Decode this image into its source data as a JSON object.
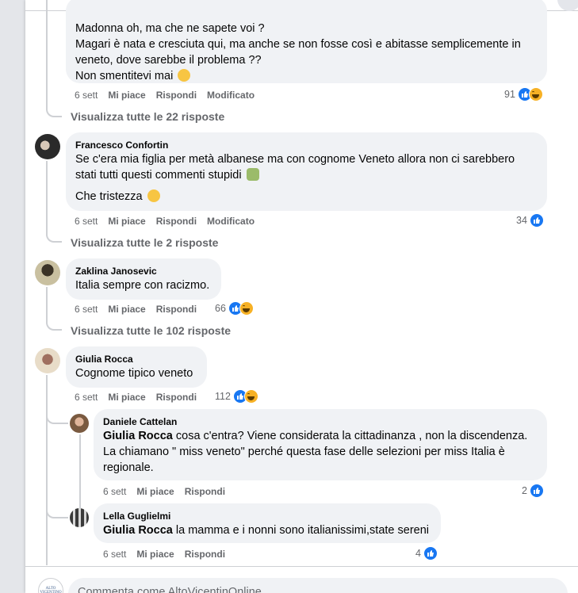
{
  "comments": [
    {
      "lines": [
        "Madonna oh, ma che ne sapete voi ?",
        "Magari è nata e cresciuta qui, ma anche se non fosse così e abitasse semplicemente in",
        "veneto, dove sarebbe il problema ??",
        "Non smentitevi mai"
      ],
      "time": "6 sett",
      "like": "Mi piace",
      "reply": "Rispondi",
      "edited": "Modificato",
      "count": "91",
      "viewall": "Visualizza tutte le 22 risposte"
    },
    {
      "name": "Francesco Confortin",
      "lines": [
        "Se c'era mia figlia per metà albanese ma con cognome Veneto allora non ci sarebbero",
        "stati tutti questi commenti stupidi"
      ],
      "line3": "Che tristezza",
      "time": "6 sett",
      "like": "Mi piace",
      "reply": "Rispondi",
      "edited": "Modificato",
      "count": "34",
      "viewall": "Visualizza tutte le 2 risposte"
    },
    {
      "name": "Zaklina Janosevic",
      "text": "Italia sempre con racizmo.",
      "time": "6 sett",
      "like": "Mi piace",
      "reply": "Rispondi",
      "count": "66",
      "viewall": "Visualizza tutte le 102 risposte"
    },
    {
      "name": "Giulia Rocca",
      "text": "Cognome tipico veneto",
      "time": "6 sett",
      "like": "Mi piace",
      "reply": "Rispondi",
      "count": "112"
    }
  ],
  "replies": [
    {
      "name": "Daniele Cattelan",
      "tag": "Giulia Rocca",
      "line1": "cosa c'entra? Viene considerata la cittadinanza , non la discendenza.",
      "line2": "La chiamano \" miss veneto\" perché questa fase delle selezioni per miss Italia è",
      "line3": "regionale.",
      "time": "6 sett",
      "like": "Mi piace",
      "reply": "Rispondi",
      "count": "2"
    },
    {
      "name": "Lella Guglielmi",
      "tag": "Giulia Rocca",
      "line1": "la mamma e i nonni sono italianissimi,state sereni",
      "time": "6 sett",
      "like": "Mi piace",
      "reply": "Rispondi",
      "count": "4"
    }
  ],
  "composer": {
    "placeholder": "Commenta come AltoVicentinOnline",
    "avatar_text": "ALTO VICENTINO"
  },
  "colors": {
    "like": "#1877f2",
    "haha": "#f7b125",
    "bubble": "#f0f2f5",
    "meta": "#65676b"
  }
}
